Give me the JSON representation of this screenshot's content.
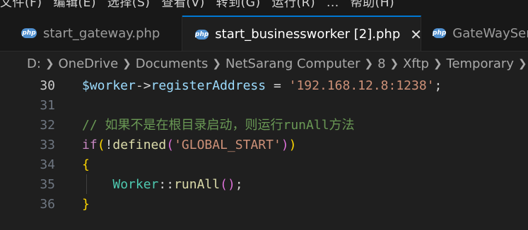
{
  "menu": {
    "items": [
      "文件(F)",
      "编辑(E)",
      "选择(S)",
      "查看(V)",
      "转到(G)",
      "运行(R)",
      "...",
      "帮助(H)"
    ]
  },
  "tabs": [
    {
      "label": "start_gateway.php",
      "icon": "php-icon",
      "active": false
    },
    {
      "label": "start_businessworker [2].php",
      "icon": "php-icon",
      "active": true
    },
    {
      "label": "GateWayServer.php",
      "icon": "php-icon",
      "active": false
    }
  ],
  "breadcrumb": {
    "segments": [
      "D:",
      "OneDrive",
      "Documents",
      "NetSarang Computer",
      "8",
      "Xftp",
      "Temporary"
    ]
  },
  "editor": {
    "lines": [
      {
        "number": "30",
        "current": true,
        "tokens": [
          {
            "t": "$worker",
            "c": "t-var"
          },
          {
            "t": "->",
            "c": "t-op"
          },
          {
            "t": "registerAddress",
            "c": "t-var"
          },
          {
            "t": " = ",
            "c": "t-op"
          },
          {
            "t": "'192.168.12.8:1238'",
            "c": "t-str"
          },
          {
            "t": ";",
            "c": "t-op"
          }
        ]
      },
      {
        "number": "31",
        "current": false,
        "tokens": []
      },
      {
        "number": "32",
        "current": false,
        "tokens": [
          {
            "t": "// 如果不是在根目录启动，则运行runAll方法",
            "c": "t-comment"
          }
        ]
      },
      {
        "number": "33",
        "current": false,
        "tokens": [
          {
            "t": "if",
            "c": "t-kw"
          },
          {
            "t": "(",
            "c": "t-brace-1"
          },
          {
            "t": "!",
            "c": "t-op"
          },
          {
            "t": "defined",
            "c": "t-fn"
          },
          {
            "t": "(",
            "c": "t-brace-2"
          },
          {
            "t": "'GLOBAL_START'",
            "c": "t-str"
          },
          {
            "t": ")",
            "c": "t-brace-2"
          },
          {
            "t": ")",
            "c": "t-brace-1"
          }
        ]
      },
      {
        "number": "34",
        "current": false,
        "tokens": [
          {
            "t": "{",
            "c": "t-brace-1"
          }
        ]
      },
      {
        "number": "35",
        "current": false,
        "tokens": [
          {
            "t": "    ",
            "c": "t-op"
          },
          {
            "t": "Worker",
            "c": "t-class"
          },
          {
            "t": "::",
            "c": "t-op"
          },
          {
            "t": "runAll",
            "c": "t-fn"
          },
          {
            "t": "(",
            "c": "t-brace-2"
          },
          {
            "t": ")",
            "c": "t-brace-2"
          },
          {
            "t": ";",
            "c": "t-op"
          }
        ]
      },
      {
        "number": "36",
        "current": false,
        "tokens": [
          {
            "t": "}",
            "c": "t-brace-1"
          }
        ]
      }
    ]
  }
}
